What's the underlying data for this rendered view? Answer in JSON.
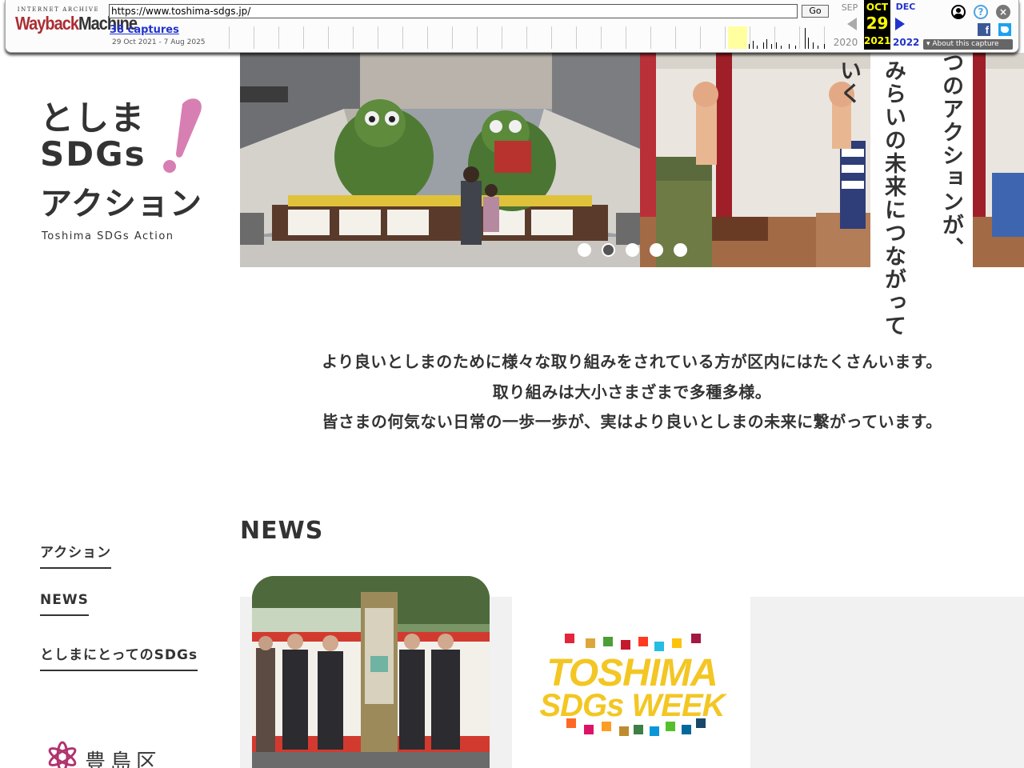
{
  "wayback": {
    "logo_top": "INTERNET ARCHIVE",
    "logo_main_a": "Wayback",
    "logo_main_b": "Machine",
    "url": "https://www.toshima-sdgs.jp/",
    "go_label": "Go",
    "captures": "38 captures",
    "range": "29 Oct 2021 - 7 Aug 2025",
    "prev_month": "SEP",
    "prev_year": "2020",
    "cur_month": "OCT",
    "cur_day": "29",
    "cur_year": "2021",
    "next_month": "DEC",
    "next_year": "2022",
    "about": "About this capture",
    "help_glyph": "?",
    "close_glyph": "×",
    "facebook_glyph": "f",
    "colors": {
      "year_highlight": "#ffffa0",
      "current": "#000000",
      "current_text": "#ffff00",
      "link": "#2233cc"
    },
    "icons": [
      "user-icon",
      "help-icon",
      "close-icon",
      "facebook-icon",
      "twitter-icon",
      "prev-arrow-icon",
      "next-arrow-icon"
    ]
  },
  "logo": {
    "line1": "としま",
    "line2": "SDGs",
    "line3": "アクション",
    "english": "Toshima SDGs Action",
    "accent": "#d77fb3"
  },
  "nav": {
    "items": [
      {
        "label": "アクション"
      },
      {
        "label": "NEWS"
      },
      {
        "label": "としまにとってのSDGs"
      }
    ]
  },
  "ward": {
    "name": "豊島区"
  },
  "hero": {
    "catch_right": "ひとつのアクションが、",
    "catch_left": "みらいの未来につながっていく",
    "slides": 5,
    "active_slide": 2
  },
  "intro": {
    "lines": [
      "より良いとしまのために様々な取り組みをされている方が区内にはたくさんいます。",
      "取り組みは大小さまざまで多種多様。",
      "皆さまの何気ない日常の一歩一歩が、実はより良いとしまの未来に繋がっています。"
    ]
  },
  "news": {
    "title": "NEWS",
    "cards": [
      {
        "image": "ceremony-photo"
      },
      {
        "image": "sdgs-week-logo",
        "logo_line1": "TOSHIMA",
        "logo_line2": "SDGs WEEK"
      }
    ]
  }
}
